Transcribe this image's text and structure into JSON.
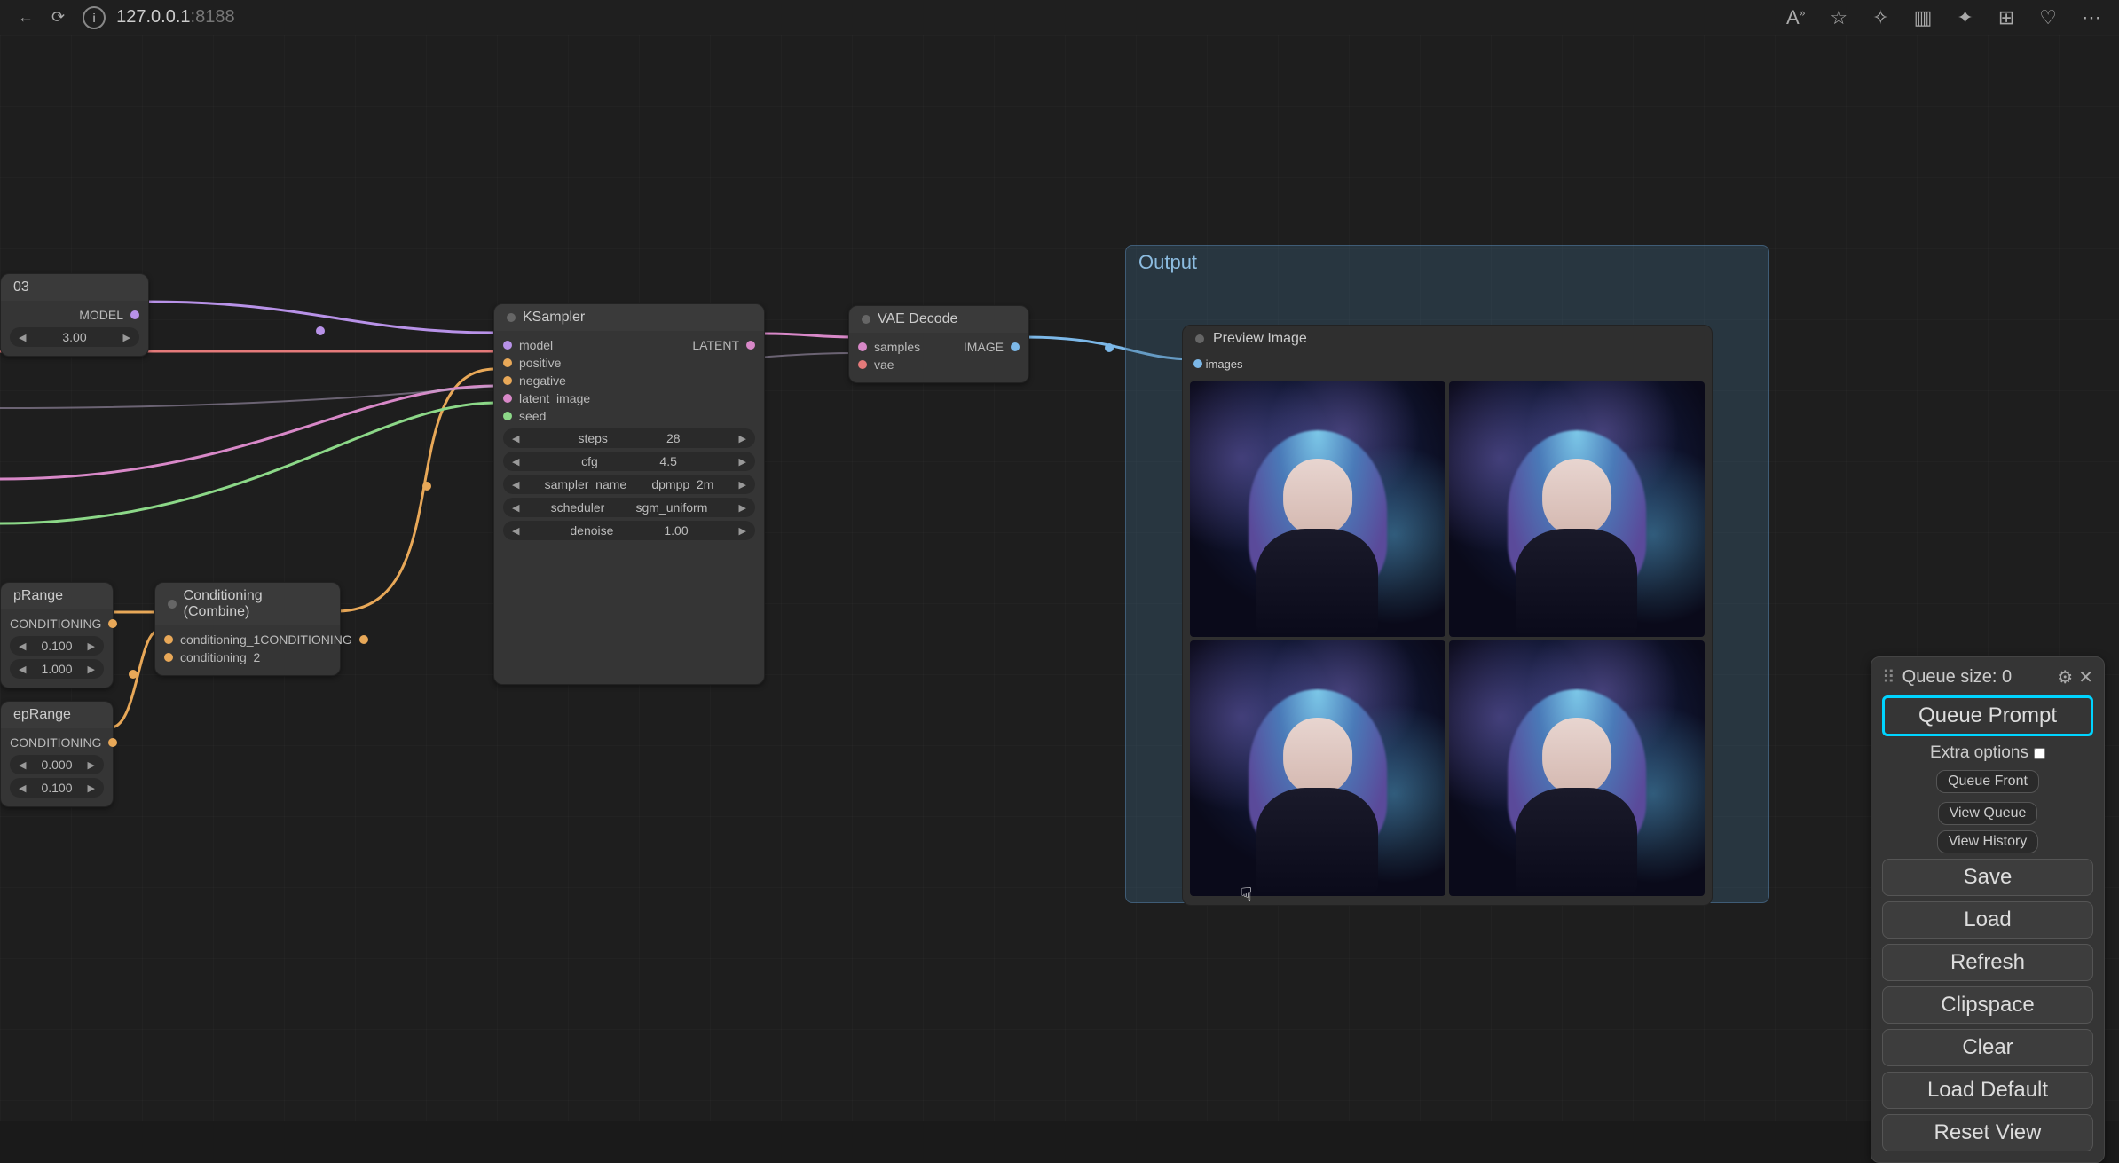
{
  "browser": {
    "url_host": "127.0.0.1",
    "url_port": ":8188"
  },
  "group": {
    "title": "Output"
  },
  "nodes": {
    "model_stub": {
      "title": "03",
      "out_label": "MODEL",
      "widget_value": "3.00"
    },
    "ksampler": {
      "title": "KSampler",
      "inputs": [
        "model",
        "positive",
        "negative",
        "latent_image",
        "seed"
      ],
      "output": "LATENT",
      "widgets": [
        {
          "name": "steps",
          "value": "28"
        },
        {
          "name": "cfg",
          "value": "4.5"
        },
        {
          "name": "sampler_name",
          "value": "dpmpp_2m"
        },
        {
          "name": "scheduler",
          "value": "sgm_uniform"
        },
        {
          "name": "denoise",
          "value": "1.00"
        }
      ]
    },
    "vae_decode": {
      "title": "VAE Decode",
      "inputs": [
        "samples",
        "vae"
      ],
      "output": "IMAGE"
    },
    "preview": {
      "title": "Preview Image",
      "input": "images"
    },
    "conditioning_combine": {
      "title": "Conditioning (Combine)",
      "inputs": [
        "conditioning_1",
        "conditioning_2"
      ],
      "output": "CONDITIONING"
    },
    "range1": {
      "title": "pRange",
      "output": "CONDITIONING",
      "w1": "0.100",
      "w2": "1.000"
    },
    "range2": {
      "title": "epRange",
      "output": "CONDITIONING",
      "w1": "0.000",
      "w2": "0.100"
    }
  },
  "panel": {
    "queue_size_label": "Queue size:",
    "queue_size_value": "0",
    "queue_prompt": "Queue Prompt",
    "extra_options": "Extra options",
    "queue_front": "Queue Front",
    "view_queue": "View Queue",
    "view_history": "View History",
    "save": "Save",
    "load": "Load",
    "refresh": "Refresh",
    "clipspace": "Clipspace",
    "clear": "Clear",
    "load_default": "Load Default",
    "reset_view": "Reset View"
  }
}
